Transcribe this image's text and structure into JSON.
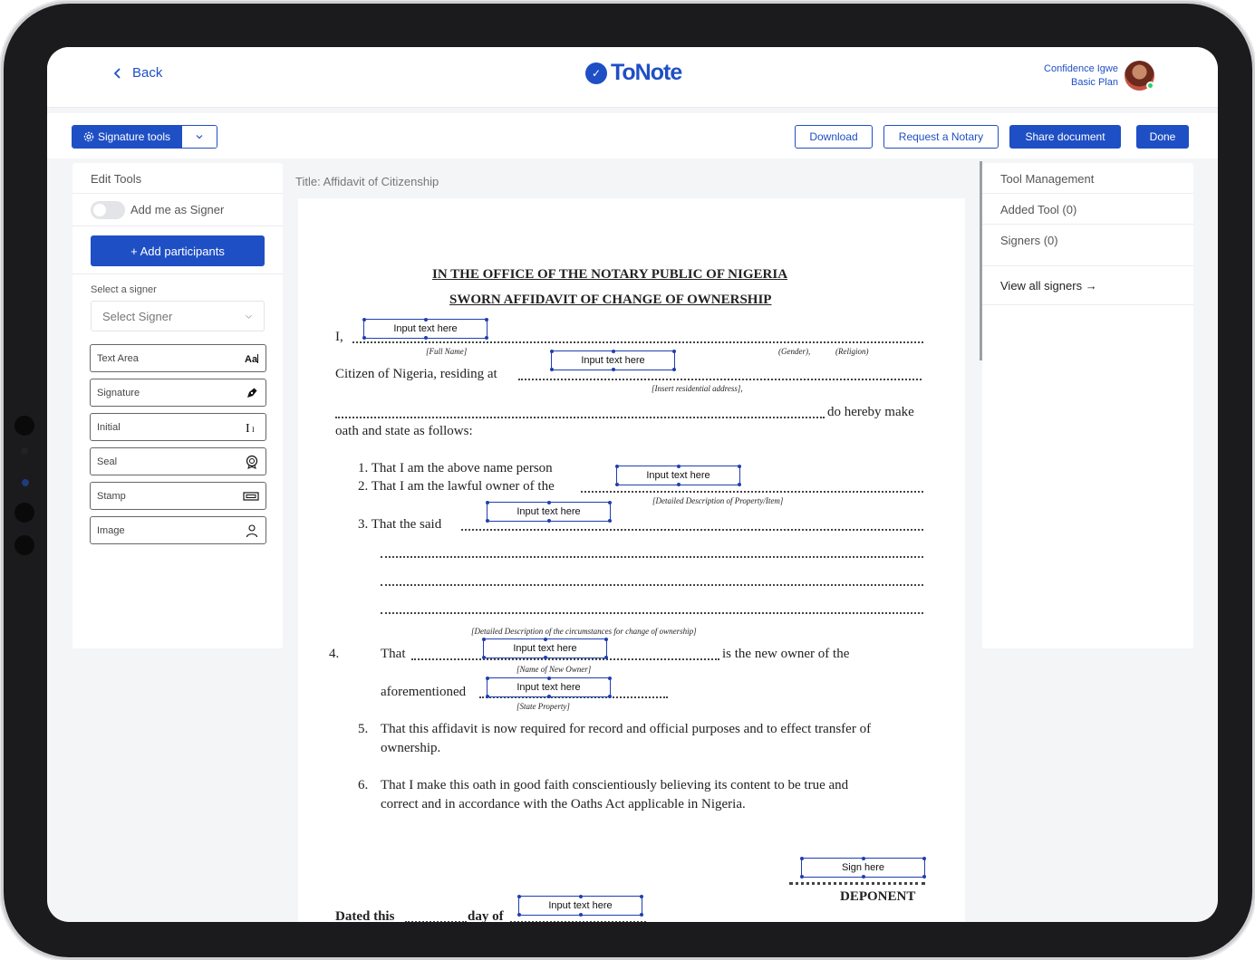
{
  "header": {
    "back_label": "Back",
    "brand": "ToNote",
    "user_name": "Confidence Igwe",
    "user_plan": "Basic Plan"
  },
  "toolbar": {
    "signature_tools": "Signature tools",
    "download": "Download",
    "request_notary": "Request a Notary",
    "share": "Share document",
    "done": "Done"
  },
  "edit_tools": {
    "title": "Edit Tools",
    "add_me": "Add me as Signer",
    "add_participants": "+ Add participants",
    "select_label": "Select a signer",
    "select_placeholder": "Select Signer",
    "tools": [
      {
        "label": "Text Area",
        "icon": "text-area-icon"
      },
      {
        "label": "Signature",
        "icon": "pen-icon"
      },
      {
        "label": "Initial",
        "icon": "initial-icon"
      },
      {
        "label": "Seal",
        "icon": "seal-icon"
      },
      {
        "label": "Stamp",
        "icon": "stamp-icon"
      },
      {
        "label": "Image",
        "icon": "person-icon"
      }
    ]
  },
  "document": {
    "title": "Title: Affidavit of Citizenship",
    "heading1": "IN THE OFFICE OF THE NOTARY PUBLIC OF NIGERIA",
    "heading2": "SWORN AFFIDAVIT OF CHANGE OF OWNERSHIP",
    "i_label": "I,",
    "full_name": "[Full Name]",
    "gender": "(Gender),",
    "religion": "(Religion)",
    "citizen": "Citizen of Nigeria, residing at",
    "address_hint": "[Insert residential address],",
    "hereby": "do hereby make",
    "oath": "oath and state as follows:",
    "item1": "1.  That I am the above name person",
    "item2": "2.  That I am the lawful owner of the",
    "property_hint": "[Detailed Description of Property/Item]",
    "item3": "3.  That the said",
    "circumstances_hint": "[Detailed Description of the circumstances for change of ownership]",
    "item4_num": "4.",
    "item4_that": "That",
    "item4_rest": "is the new owner of the",
    "new_owner_hint": "[Name of New Owner]",
    "aforementioned": "aforementioned",
    "state_property_hint": "[State Property]",
    "item5_num": "5.",
    "item5_a": "That this affidavit is now required for record and official purposes and to effect transfer of",
    "item5_b": "ownership.",
    "item6_num": "6.",
    "item6_a": "That I make this oath in good faith conscientiously believing its content to be true and",
    "item6_b": "correct and in accordance with the Oaths Act applicable in Nigeria.",
    "deponent": "DEPONENT",
    "dated": "Dated this",
    "day_of": "day of",
    "field_label": "Input text here",
    "sign_label": "Sign here"
  },
  "tool_management": {
    "title": "Tool Management",
    "added": "Added Tool (0)",
    "signers": "Signers (0)",
    "view_all": "View all signers →"
  },
  "colors": {
    "brand": "#1f4fc4",
    "field_border": "#1f3fb0"
  }
}
